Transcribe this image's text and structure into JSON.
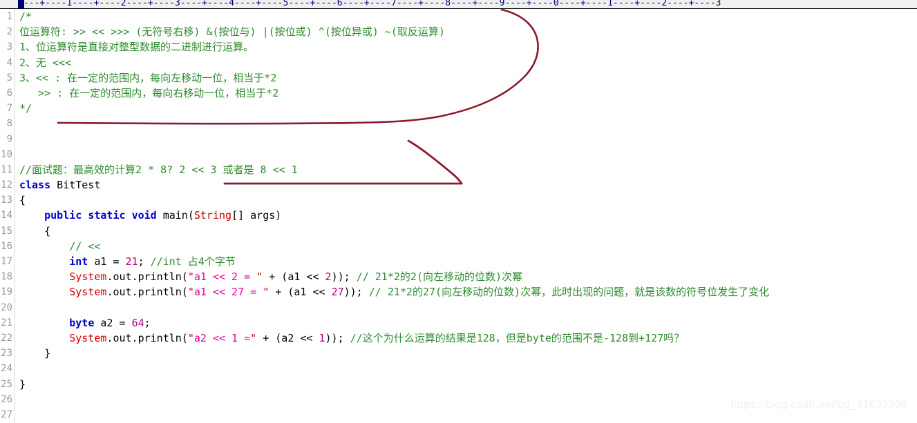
{
  "ruler": {
    "text": "----+----1----+----2----+----3----+----4----+----5----+----6----+----7----+----8----+----9----+----0----+----1----+----2----+----3",
    "caret_column": 1,
    "color": "#000080"
  },
  "watermark": {
    "text": "https://blog.csdn.net/qq_41633396"
  },
  "editor": {
    "language": "java",
    "background": "#ffffff",
    "line_number_color": "#999999",
    "annotation_color": "#8b1a2b",
    "lines": [
      {
        "n": "1",
        "text": "/*"
      },
      {
        "n": "2",
        "text": "位运算符: >> << >>> (无符号右移) &(按位与) |(按位或) ^(按位异或) ~(取反运算)"
      },
      {
        "n": "3",
        "text": "1、位运算符是直接对整型数据的二进制进行运算。"
      },
      {
        "n": "4",
        "text": "2、无 <<<"
      },
      {
        "n": "5",
        "text": "3、<< : 在一定的范围内，每向左移动一位，相当于*2"
      },
      {
        "n": "6",
        "text": "   >> : 在一定的范围内，每向右移动一位，相当于*2"
      },
      {
        "n": "7",
        "text": "*/"
      },
      {
        "n": "8",
        "text": ""
      },
      {
        "n": "9",
        "text": ""
      },
      {
        "n": "10",
        "text": ""
      },
      {
        "n": "11",
        "text": "//面试题：最高效的计算2 * 8? 2 << 3 或者是 8 << 1"
      },
      {
        "n": "12",
        "text": "class BitTest"
      },
      {
        "n": "13",
        "text": "{"
      },
      {
        "n": "14",
        "text": "    public static void main(String[] args)"
      },
      {
        "n": "15",
        "text": "    {"
      },
      {
        "n": "16",
        "text": "        // <<"
      },
      {
        "n": "17",
        "text": "        int a1 = 21; //int 占4个字节"
      },
      {
        "n": "18",
        "text": "        System.out.println(\"a1 << 2 = \" + (a1 << 2)); // 21*2的2(向左移动的位数)次幂"
      },
      {
        "n": "19",
        "text": "        System.out.println(\"a1 << 27 = \" + (a1 << 27)); // 21*2的27(向左移动的位数)次幂，此时出现的问题，就是该数的符号位发生了变化"
      },
      {
        "n": "20",
        "text": ""
      },
      {
        "n": "21",
        "text": "        byte a2 = 64;"
      },
      {
        "n": "22",
        "text": "        System.out.println(\"a2 << 1 =\" + (a2 << 1)); //这个为什么运算的结果是128，但是byte的范围不是-128到+127吗？"
      },
      {
        "n": "23",
        "text": "    }"
      },
      {
        "n": "24",
        "text": ""
      },
      {
        "n": "25",
        "text": "}"
      },
      {
        "n": "26",
        "text": ""
      },
      {
        "n": "27",
        "text": ""
      }
    ],
    "tokens": {
      "l1": [
        {
          "t": "/*",
          "c": "cmt"
        }
      ],
      "l2": [
        {
          "t": "位运算符: >> << >>> (无符号右移) &(按位与) |(按位或) ^(按位异或) ~(取反运算)",
          "c": "cmt"
        }
      ],
      "l3": [
        {
          "t": "1、位运算符是直接对整型数据的二进制进行运算。",
          "c": "cmt"
        }
      ],
      "l4": [
        {
          "t": "2、无 <<<",
          "c": "cmt"
        }
      ],
      "l5": [
        {
          "t": "3、<< : 在一定的范围内，每向左移动一位，相当于*2",
          "c": "cmt"
        }
      ],
      "l6": [
        {
          "t": "   >> : 在一定的范围内，每向右移动一位，相当于*2",
          "c": "cmt"
        }
      ],
      "l7": [
        {
          "t": "*/",
          "c": "cmt"
        }
      ],
      "l11": [
        {
          "t": "//面试题：最高效的计算2 * 8? 2 << 3 或者是 8 << 1",
          "c": "cmt"
        }
      ],
      "l12": [
        {
          "t": "class",
          "c": "kw"
        },
        {
          "t": " BitTest",
          "c": "pln"
        }
      ],
      "l13": [
        {
          "t": "{",
          "c": "pln"
        }
      ],
      "l14": [
        {
          "t": "    ",
          "c": "pln"
        },
        {
          "t": "public",
          "c": "kw"
        },
        {
          "t": " ",
          "c": "pln"
        },
        {
          "t": "static",
          "c": "kw"
        },
        {
          "t": " ",
          "c": "pln"
        },
        {
          "t": "void",
          "c": "kw"
        },
        {
          "t": " main(",
          "c": "pln"
        },
        {
          "t": "String",
          "c": "typ"
        },
        {
          "t": "[] args)",
          "c": "pln"
        }
      ],
      "l15": [
        {
          "t": "    {",
          "c": "pln"
        }
      ],
      "l16": [
        {
          "t": "        ",
          "c": "pln"
        },
        {
          "t": "// <<",
          "c": "cmt"
        }
      ],
      "l17": [
        {
          "t": "        ",
          "c": "pln"
        },
        {
          "t": "int",
          "c": "kw"
        },
        {
          "t": " a1 = ",
          "c": "pln"
        },
        {
          "t": "21",
          "c": "num"
        },
        {
          "t": "; ",
          "c": "pln"
        },
        {
          "t": "//int 占4个字节",
          "c": "cmt"
        }
      ],
      "l18": [
        {
          "t": "        ",
          "c": "pln"
        },
        {
          "t": "System",
          "c": "typ"
        },
        {
          "t": ".out.println(",
          "c": "pln"
        },
        {
          "t": "\"",
          "c": "str"
        },
        {
          "t": "a1 << 2 = ",
          "c": "strm"
        },
        {
          "t": "\"",
          "c": "str"
        },
        {
          "t": " + (a1 << ",
          "c": "pln"
        },
        {
          "t": "2",
          "c": "num"
        },
        {
          "t": ")); ",
          "c": "pln"
        },
        {
          "t": "// 21*2的2(向左移动的位数)次幂",
          "c": "cmt"
        }
      ],
      "l19": [
        {
          "t": "        ",
          "c": "pln"
        },
        {
          "t": "System",
          "c": "typ"
        },
        {
          "t": ".out.println(",
          "c": "pln"
        },
        {
          "t": "\"",
          "c": "str"
        },
        {
          "t": "a1 << 27 = ",
          "c": "strm"
        },
        {
          "t": "\"",
          "c": "str"
        },
        {
          "t": " + (a1 << ",
          "c": "pln"
        },
        {
          "t": "27",
          "c": "num"
        },
        {
          "t": ")); ",
          "c": "pln"
        },
        {
          "t": "// 21*2的27(向左移动的位数)次幂，此时出现的问题，就是该数的符号位发生了变化",
          "c": "cmt"
        }
      ],
      "l21": [
        {
          "t": "        ",
          "c": "pln"
        },
        {
          "t": "byte",
          "c": "kw"
        },
        {
          "t": " a2 = ",
          "c": "pln"
        },
        {
          "t": "64",
          "c": "num"
        },
        {
          "t": ";",
          "c": "pln"
        }
      ],
      "l22": [
        {
          "t": "        ",
          "c": "pln"
        },
        {
          "t": "System",
          "c": "typ"
        },
        {
          "t": ".out.println(",
          "c": "pln"
        },
        {
          "t": "\"",
          "c": "str"
        },
        {
          "t": "a2 << 1 =",
          "c": "strm"
        },
        {
          "t": "\"",
          "c": "str"
        },
        {
          "t": " + (a2 << ",
          "c": "pln"
        },
        {
          "t": "1",
          "c": "num"
        },
        {
          "t": ")); ",
          "c": "pln"
        },
        {
          "t": "//这个为什么运算的结果是128，但是byte的范围不是-128到+127吗？",
          "c": "cmt"
        }
      ],
      "l23": [
        {
          "t": "    }",
          "c": "pln"
        }
      ],
      "l25": [
        {
          "t": "}",
          "c": "pln"
        }
      ]
    }
  }
}
